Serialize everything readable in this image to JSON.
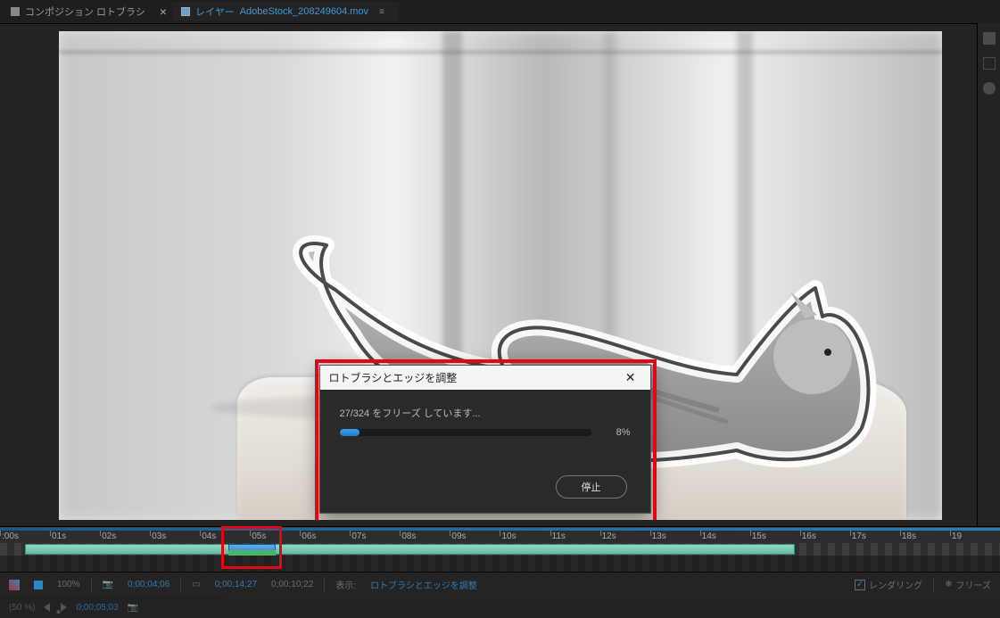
{
  "tabs": {
    "comp": {
      "label": "コンポジション ロトブラシ"
    },
    "layer": {
      "prefix": "レイヤー",
      "filename": "AdobeStock_208249604.mov"
    }
  },
  "dialog": {
    "title": "ロトブラシとエッジを調整",
    "status": "27/324 をフリーズ しています...",
    "percent_label": "8%",
    "percent_value": 8,
    "stop_label": "停止"
  },
  "timeline": {
    "ticks": [
      ":00s",
      "01s",
      "02s",
      "03s",
      "04s",
      "05s",
      "06s",
      "07s",
      "08s",
      "09s",
      "10s",
      "11s",
      "12s",
      "13s",
      "14s",
      "15s",
      "16s",
      "17s",
      "18s",
      "19"
    ],
    "roto_span_start_pct": 2.5,
    "roto_span_end_pct": 79.5,
    "playhead_start_pct": 22.8,
    "playhead_end_pct": 27.6
  },
  "bottombar": {
    "zoom": "100%",
    "tc1": "0;00;04;06",
    "tc2": "0;00;14;27",
    "tc3": "0;00;10;22",
    "view_label": "表示:",
    "view_value": "ロトブラシとエッジを調整",
    "rendering_label": "レンダリング",
    "freeze_label": "フリーズ"
  },
  "footer": {
    "zoom_pct": "(50 %)",
    "tc": "0;00;05;03"
  }
}
